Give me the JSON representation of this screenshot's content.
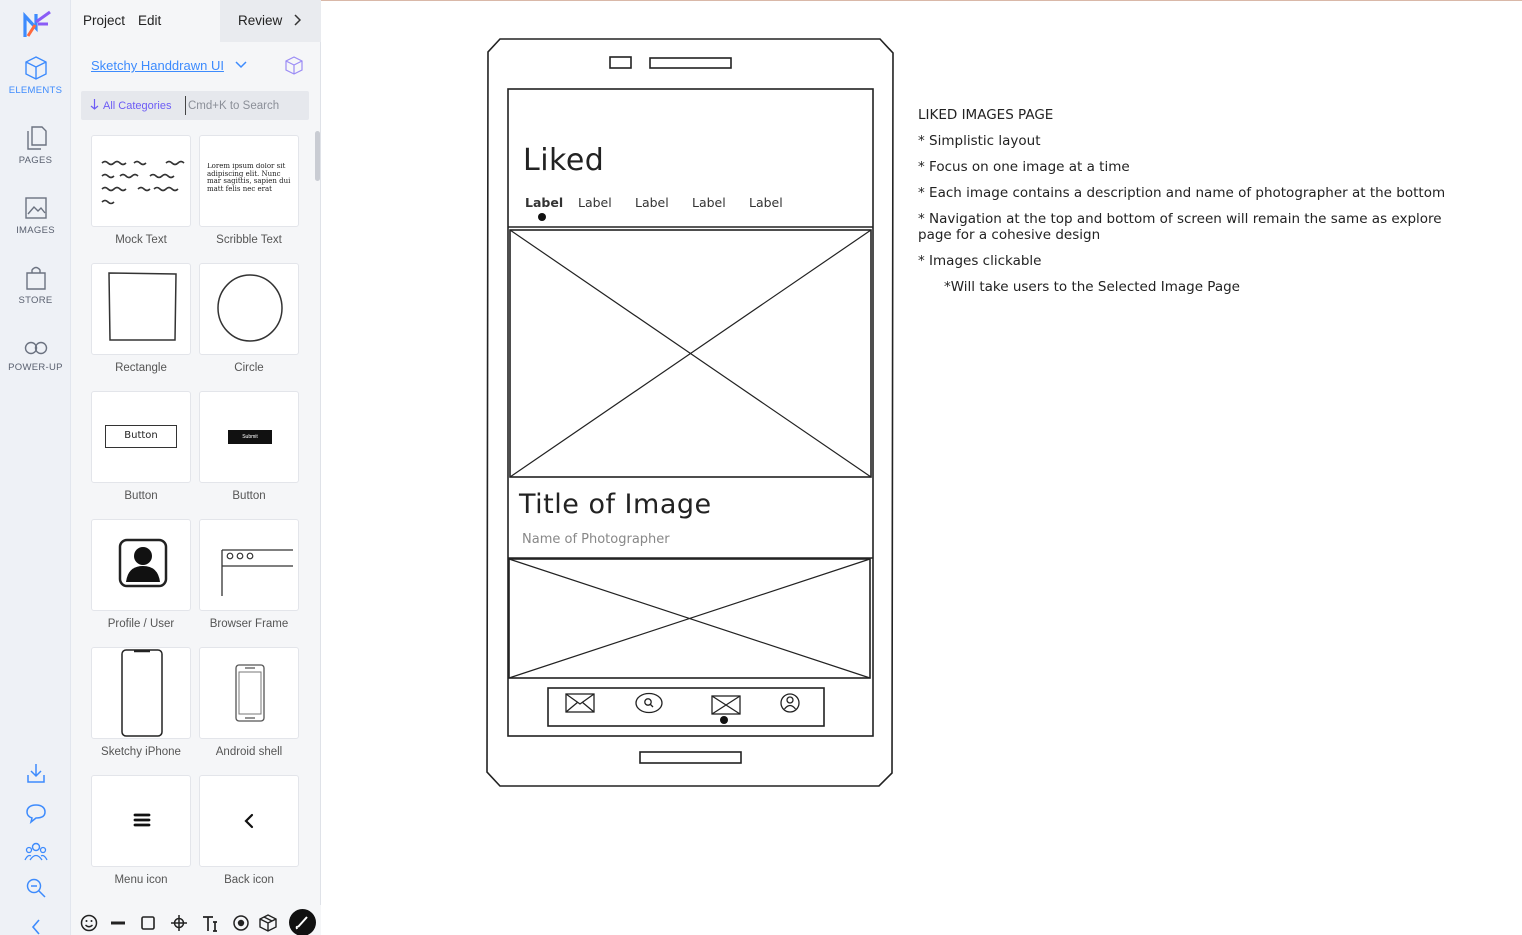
{
  "rail": {
    "items": [
      {
        "label": "ELEMENTS"
      },
      {
        "label": "PAGES"
      },
      {
        "label": "IMAGES"
      },
      {
        "label": "STORE"
      },
      {
        "label": "POWER-UP"
      }
    ]
  },
  "menu": {
    "project": "Project",
    "edit": "Edit",
    "review": "Review"
  },
  "library": {
    "name": "Sketchy Handdrawn UI",
    "categories_button": "All Categories",
    "search_placeholder": "Cmd+K to Search",
    "tiles": [
      {
        "label": "Mock Text"
      },
      {
        "label": "Scribble Text",
        "preview": "Lorem ipsum dolor sit adipiscing elit. Nunc mar sagittis, sapien dui matt felis nec erat"
      },
      {
        "label": "Rectangle"
      },
      {
        "label": "Circle"
      },
      {
        "label": "Button",
        "preview": "Button"
      },
      {
        "label": "Button",
        "preview": "Submit"
      },
      {
        "label": "Profile / User"
      },
      {
        "label": "Browser Frame"
      },
      {
        "label": "Sketchy iPhone"
      },
      {
        "label": "Android shell"
      },
      {
        "label": "Menu icon"
      },
      {
        "label": "Back icon"
      }
    ]
  },
  "wireframe": {
    "heading": "Liked",
    "tabs": [
      "Label",
      "Label",
      "Label",
      "Label",
      "Label"
    ],
    "image_title": "Title of Image",
    "photographer": "Name of Photographer"
  },
  "notes": {
    "title": "LIKED IMAGES PAGE",
    "bullets": [
      "* Simplistic layout",
      "* Focus on one image at a time",
      "* Each image contains a description and name of photographer at the bottom",
      "* Navigation at the top and bottom of screen will remain the same as explore page for a cohesive design",
      "* Images clickable"
    ],
    "sub_bullet": "*Will take users to the Selected Image Page"
  }
}
